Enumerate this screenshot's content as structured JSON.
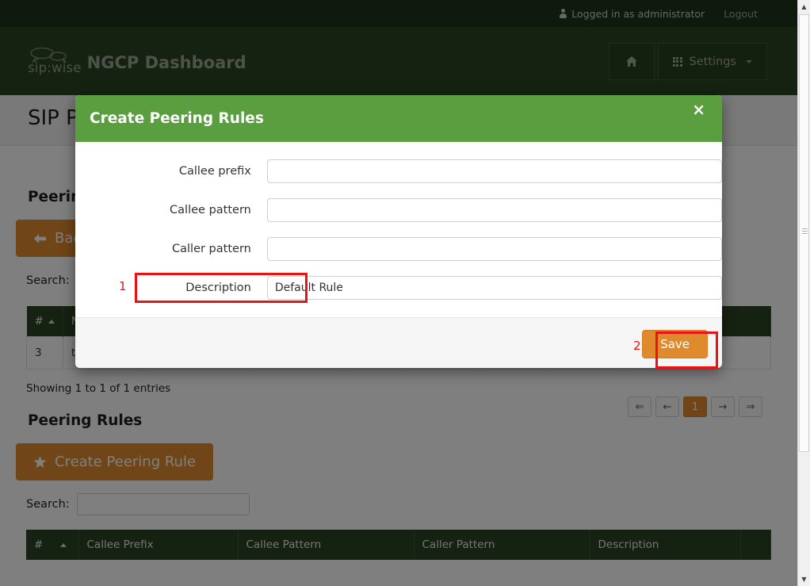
{
  "topbar": {
    "logged_in_text": "Logged in as administrator",
    "logout_label": "Logout",
    "user_icon": "user-icon"
  },
  "navbar": {
    "brand_sipwise": "sip:wise",
    "brand_title": "NGCP Dashboard",
    "home_icon": "home-icon",
    "settings_icon": "grid-icon",
    "settings_label": "Settings",
    "caret_icon": "chevron-down-icon"
  },
  "page": {
    "title": "SIP Peering"
  },
  "peering_groups": {
    "section_title": "Peering",
    "back_button_label": "Back",
    "back_icon": "arrow-left-icon",
    "search_label": "Search:",
    "search_value": "",
    "columns": [
      "#",
      "Name"
    ],
    "rows": [
      {
        "num": "3",
        "name": "test"
      }
    ],
    "showing_text": "Showing 1 to 1 of 1 entries",
    "pagination": {
      "first_label": "⇐",
      "prev_label": "←",
      "pages": [
        "1"
      ],
      "active_page": "1",
      "next_label": "→",
      "last_label": "⇒"
    }
  },
  "peering_rules": {
    "section_title": "Peering Rules",
    "create_button_label": "Create Peering Rule",
    "create_icon": "star-icon",
    "search_label": "Search:",
    "search_value": "",
    "columns": [
      "#",
      "Callee Prefix",
      "Callee Pattern",
      "Caller Pattern",
      "Description"
    ]
  },
  "modal": {
    "title": "Create Peering Rules",
    "close_icon": "close-icon",
    "close_label": "×",
    "fields": [
      {
        "label": "Callee prefix",
        "value": "",
        "placeholder": ""
      },
      {
        "label": "Callee pattern",
        "value": "",
        "placeholder": ""
      },
      {
        "label": "Caller pattern",
        "value": "",
        "placeholder": ""
      },
      {
        "label": "Description",
        "value": "Default Rule",
        "placeholder": ""
      }
    ],
    "save_label": "Save"
  },
  "annotations": [
    {
      "number": "1",
      "target": "description-field"
    },
    {
      "number": "2",
      "target": "save-button"
    }
  ],
  "colors": {
    "topbar": "#20331a",
    "navbar": "#2b4522",
    "modal_header_green": "#5a9e3f",
    "accent_orange": "#e08a2e",
    "table_header_green": "#2b4522",
    "annotation_red": "#ee1111"
  },
  "scrollbar": {
    "up_icon": "scroll-up-icon",
    "down_icon": "scroll-down-icon"
  }
}
